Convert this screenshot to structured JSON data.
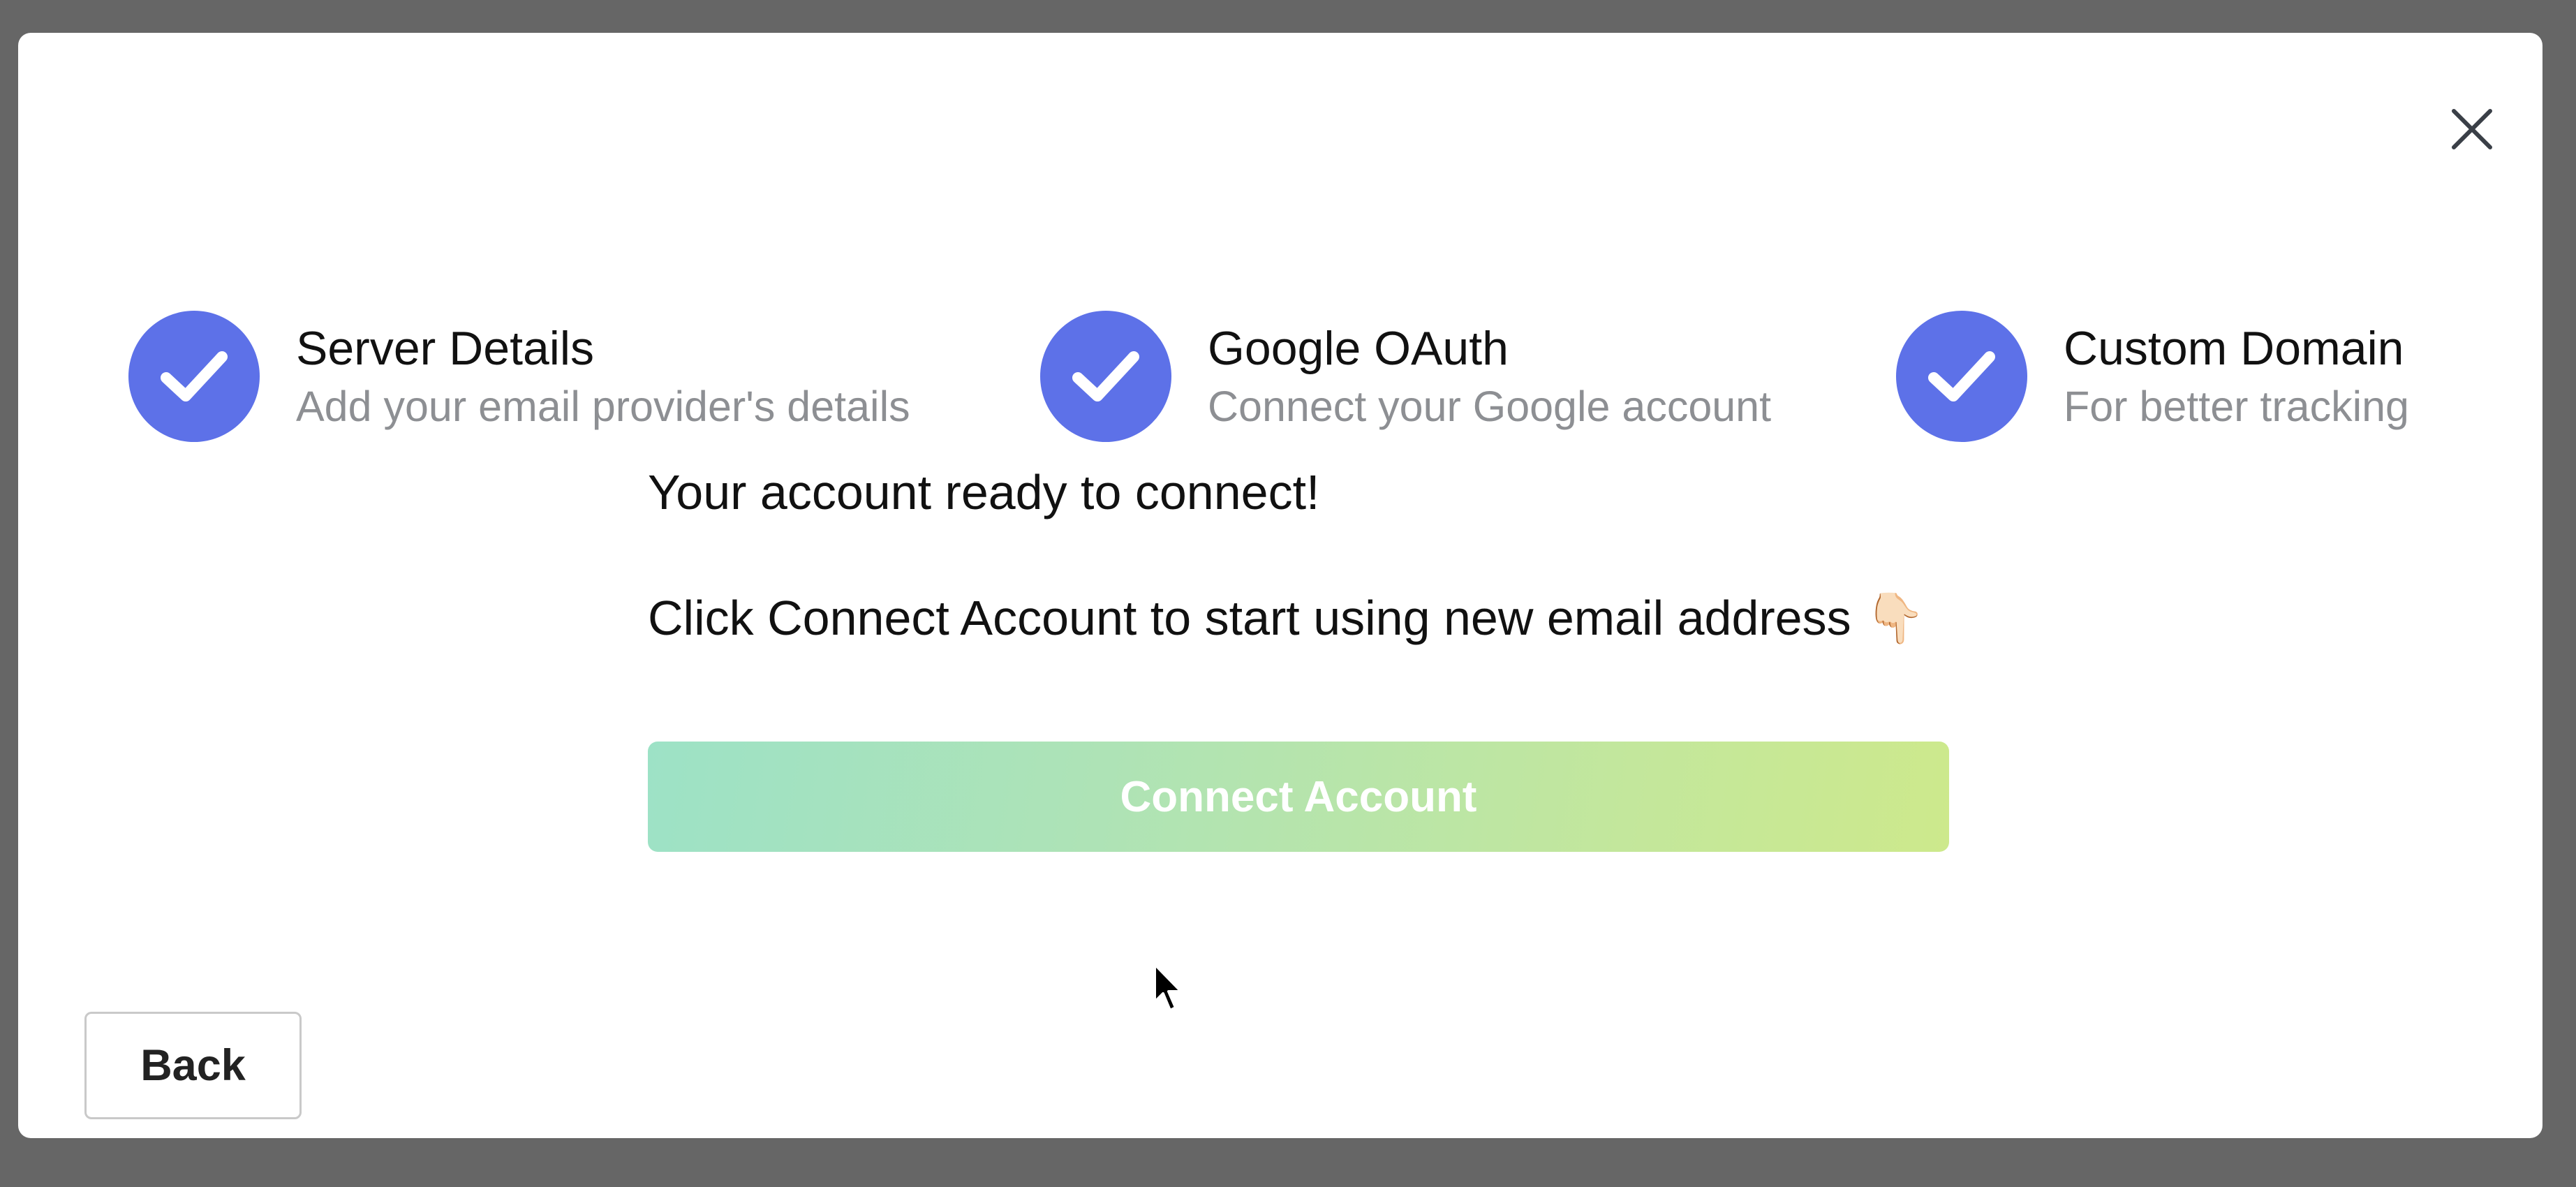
{
  "modal": {
    "close_icon": "close-icon",
    "steps": [
      {
        "title": "Server Details",
        "subtitle": "Add your email provider's details",
        "icon": "check-icon",
        "status": "complete"
      },
      {
        "title": "Google OAuth",
        "subtitle": "Connect your Google account",
        "icon": "check-icon",
        "status": "complete"
      },
      {
        "title": "Custom Domain",
        "subtitle": "For better tracking",
        "icon": "check-icon",
        "status": "complete"
      }
    ],
    "message_ready": "Your account ready to connect!",
    "message_instruction": "Click Connect Account to start using new email address",
    "message_emoji": "👇🏻",
    "connect_button_label": "Connect Account",
    "back_button_label": "Back"
  },
  "colors": {
    "overlay": "#666666",
    "step_complete": "#5d71e8",
    "connect_gradient_start": "#9de2c6",
    "connect_gradient_end": "#cde98c"
  }
}
